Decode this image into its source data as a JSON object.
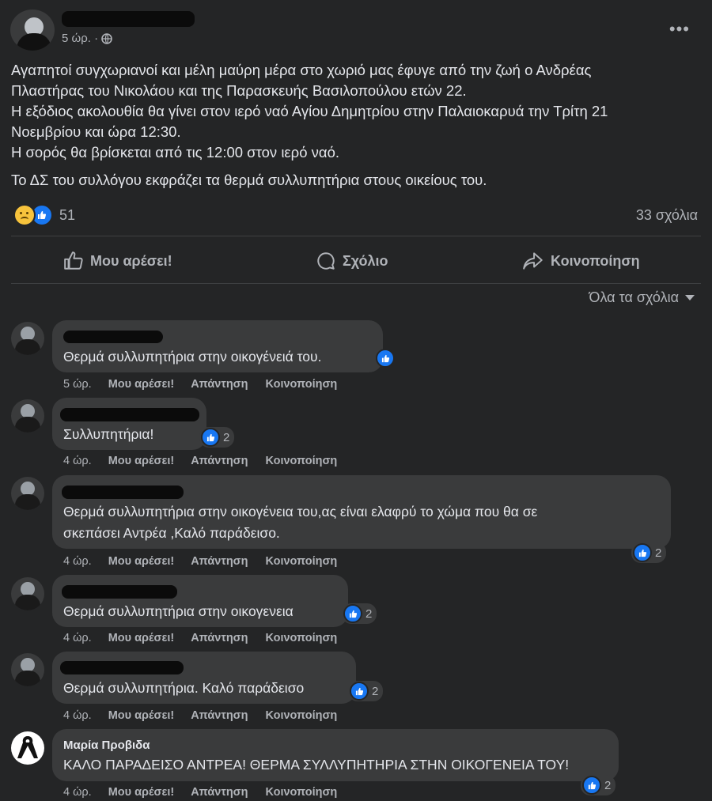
{
  "post": {
    "time": "5 ώρ. ·",
    "paragraphs": [
      "Αγαπητοί συγχωριανοί και μέλη μαύρη μέρα στο χωριό μας έφυγε από την ζωή ο Ανδρέας",
      "Πλαστήρας του Νικολάου και της Παρασκευής Βασιλοπούλου ετών 22.",
      "Η εξόδιος ακολουθία θα γίνει στον ιερό ναό Αγίου Δημητρίου στην Παλαιοκαρυά την Τρίτη 21",
      "Νοεμβρίου και ώρα 12:30.",
      "Η σορός θα βρίσκεται από τις 12:00 στον ιερό ναό."
    ],
    "closing": "Το ΔΣ του συλλόγου εκφράζει τα θερμά συλλυπητήρια στους οικείους του.",
    "reaction_count": "51",
    "comments_count": "33 σχόλια",
    "more_label": "•••"
  },
  "actions": {
    "like": "Μου αρέσει!",
    "comment": "Σχόλιο",
    "share": "Κοινοποίηση"
  },
  "filter_label": "Όλα τα σχόλια",
  "comment_actions": {
    "like": "Μου αρέσει!",
    "reply": "Απάντηση",
    "share": "Κοινοποίηση"
  },
  "comments": [
    {
      "text": "Θερμά συλλυπητήρια στην οικογένειά του.",
      "time": "5 ώρ.",
      "likes": ""
    },
    {
      "text": "Συλλυπητήρια!",
      "time": "4 ώρ.",
      "likes": "2"
    },
    {
      "text_lines": [
        "Θερμά συλλυπητήρια στην οικογένεια του,ας είναι ελαφρύ το χώμα που θα σε",
        "σκεπάσει Αντρέα ,Καλό παράδεισο."
      ],
      "time": "4 ώρ.",
      "likes": "2"
    },
    {
      "text": "Θερμά συλλυπητήρια στην οικογενεια",
      "time": "4 ώρ.",
      "likes": "2"
    },
    {
      "text": "Θερμά συλλυπητήρια. Καλό παράδεισο",
      "time": "4 ώρ.",
      "likes": "2"
    },
    {
      "name": "Μαρία Προβιδα",
      "text": "ΚΑΛΟ ΠΑΡΑΔΕΙΣΟ ΑΝΤΡΕΑ! ΘΕΡΜΑ ΣΥΛΛΥΠΗΤΗΡΙΑ ΣΤΗΝ ΟΙΚΟΓΕΝΕΙΑ ΤΟΥ!",
      "time": "4 ώρ.",
      "likes": "2"
    }
  ],
  "colors": {
    "background": "#242526",
    "bubble": "#3a3b3c",
    "like_blue": "#1877f2",
    "secondary_text": "#b0b3b8"
  }
}
